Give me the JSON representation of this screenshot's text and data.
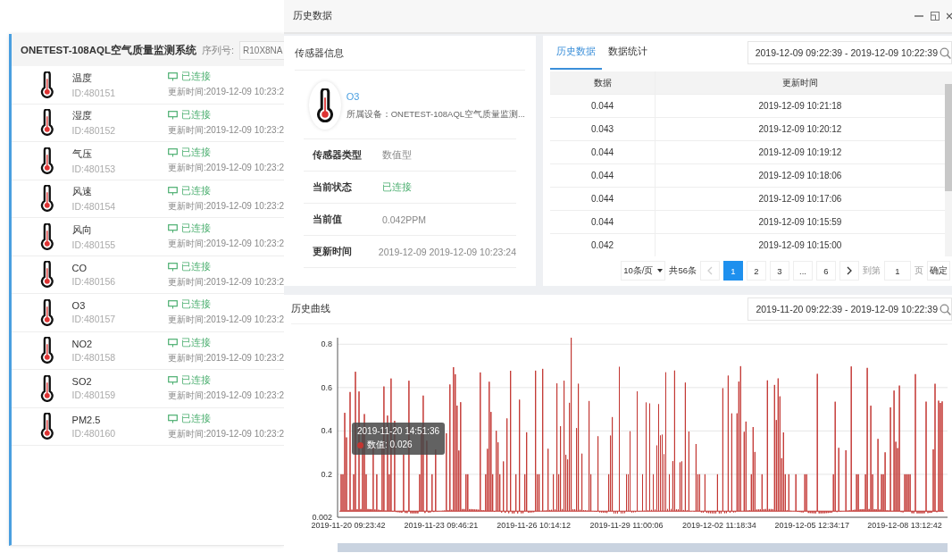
{
  "device_panel": {
    "title": "ONETEST-108AQL空气质量监测系统",
    "serial_label": "序列号:",
    "serial_value": "R10X8NA"
  },
  "sensors": [
    {
      "name": "温度",
      "id": "ID:480151",
      "status": "已连接",
      "updated": "更新时间:2019-12-09 10:23:2"
    },
    {
      "name": "湿度",
      "id": "ID:480152",
      "status": "已连接",
      "updated": "更新时间:2019-12-09 10:23:2"
    },
    {
      "name": "气压",
      "id": "ID:480153",
      "status": "已连接",
      "updated": "更新时间:2019-12-09 10:23:2"
    },
    {
      "name": "风速",
      "id": "ID:480154",
      "status": "已连接",
      "updated": "更新时间:2019-12-09 10:23:2"
    },
    {
      "name": "风向",
      "id": "ID:480155",
      "status": "已连接",
      "updated": "更新时间:2019-12-09 10:23:2"
    },
    {
      "name": "CO",
      "id": "ID:480156",
      "status": "已连接",
      "updated": "更新时间:2019-12-09 10:23:2"
    },
    {
      "name": "O3",
      "id": "ID:480157",
      "status": "已连接",
      "updated": "更新时间:2019-12-09 10:23:2"
    },
    {
      "name": "NO2",
      "id": "ID:480158",
      "status": "已连接",
      "updated": "更新时间:2019-12-09 10:23:2"
    },
    {
      "name": "SO2",
      "id": "ID:480159",
      "status": "已连接",
      "updated": "更新时间:2019-12-09 10:23:2"
    },
    {
      "name": "PM2.5",
      "id": "ID:480160",
      "status": "已连接",
      "updated": "更新时间:2019-12-09 10:23:2"
    }
  ],
  "window": {
    "title": "历史数据"
  },
  "sensor_info": {
    "title": "传感器信息",
    "name": "O3",
    "device": "所属设备：ONETEST-108AQL空气质量监测...",
    "fields": [
      {
        "label": "传感器类型",
        "value": "数值型",
        "kind": "plain"
      },
      {
        "label": "当前状态",
        "value": "已连接",
        "kind": "status"
      },
      {
        "label": "当前值",
        "value": "0.042PPM",
        "kind": "plain"
      },
      {
        "label": "更新时间",
        "value": "2019-12-09 2019-12-09 10:23:24",
        "kind": "plain"
      }
    ]
  },
  "history": {
    "tabs": [
      {
        "label": "历史数据",
        "selected": true
      },
      {
        "label": "数据统计",
        "selected": false
      }
    ],
    "range": "2019-12-09 09:22:39 - 2019-12-09 10:22:39",
    "columns": [
      "数据",
      "更新时间"
    ],
    "rows": [
      [
        "0.044",
        "2019-12-09 10:21:18"
      ],
      [
        "0.043",
        "2019-12-09 10:20:12"
      ],
      [
        "0.044",
        "2019-12-09 10:19:12"
      ],
      [
        "0.044",
        "2019-12-09 10:18:06"
      ],
      [
        "0.044",
        "2019-12-09 10:17:06"
      ],
      [
        "0.044",
        "2019-12-09 10:15:59"
      ],
      [
        "0.042",
        "2019-12-09 10:15:00"
      ]
    ],
    "pagination": {
      "page_size": "10条/页",
      "total": "共56条",
      "pages": [
        {
          "label": "1",
          "selected": true
        },
        {
          "label": "2",
          "selected": false
        },
        {
          "label": "3",
          "selected": false
        },
        {
          "label": "...",
          "selected": false
        },
        {
          "label": "6",
          "selected": false
        }
      ],
      "goto_label": "到第",
      "goto_value": "1",
      "page_unit": "页",
      "confirm": "确定"
    }
  },
  "curve": {
    "title": "历史曲线",
    "range": "2019-11-20 09:22:39 - 2019-12-09 10:22:39",
    "y_ticks": [
      "0.8",
      "0.6",
      "0.4",
      "0.2",
      "0.002"
    ],
    "x_ticks": [
      "2019-11-20 09:23:42",
      "2019-11-23 09:46:21",
      "2019-11-26 10:14:12",
      "2019-11-29 11:00:06",
      "2019-12-02 11:18:34",
      "2019-12-05 12:34:17",
      "2019-12-08 13:12:42"
    ],
    "tooltip": {
      "time": "2019-11-20 14:51:36",
      "label": "数值: 0.026"
    },
    "zoom": {
      "level": 1
    }
  }
}
